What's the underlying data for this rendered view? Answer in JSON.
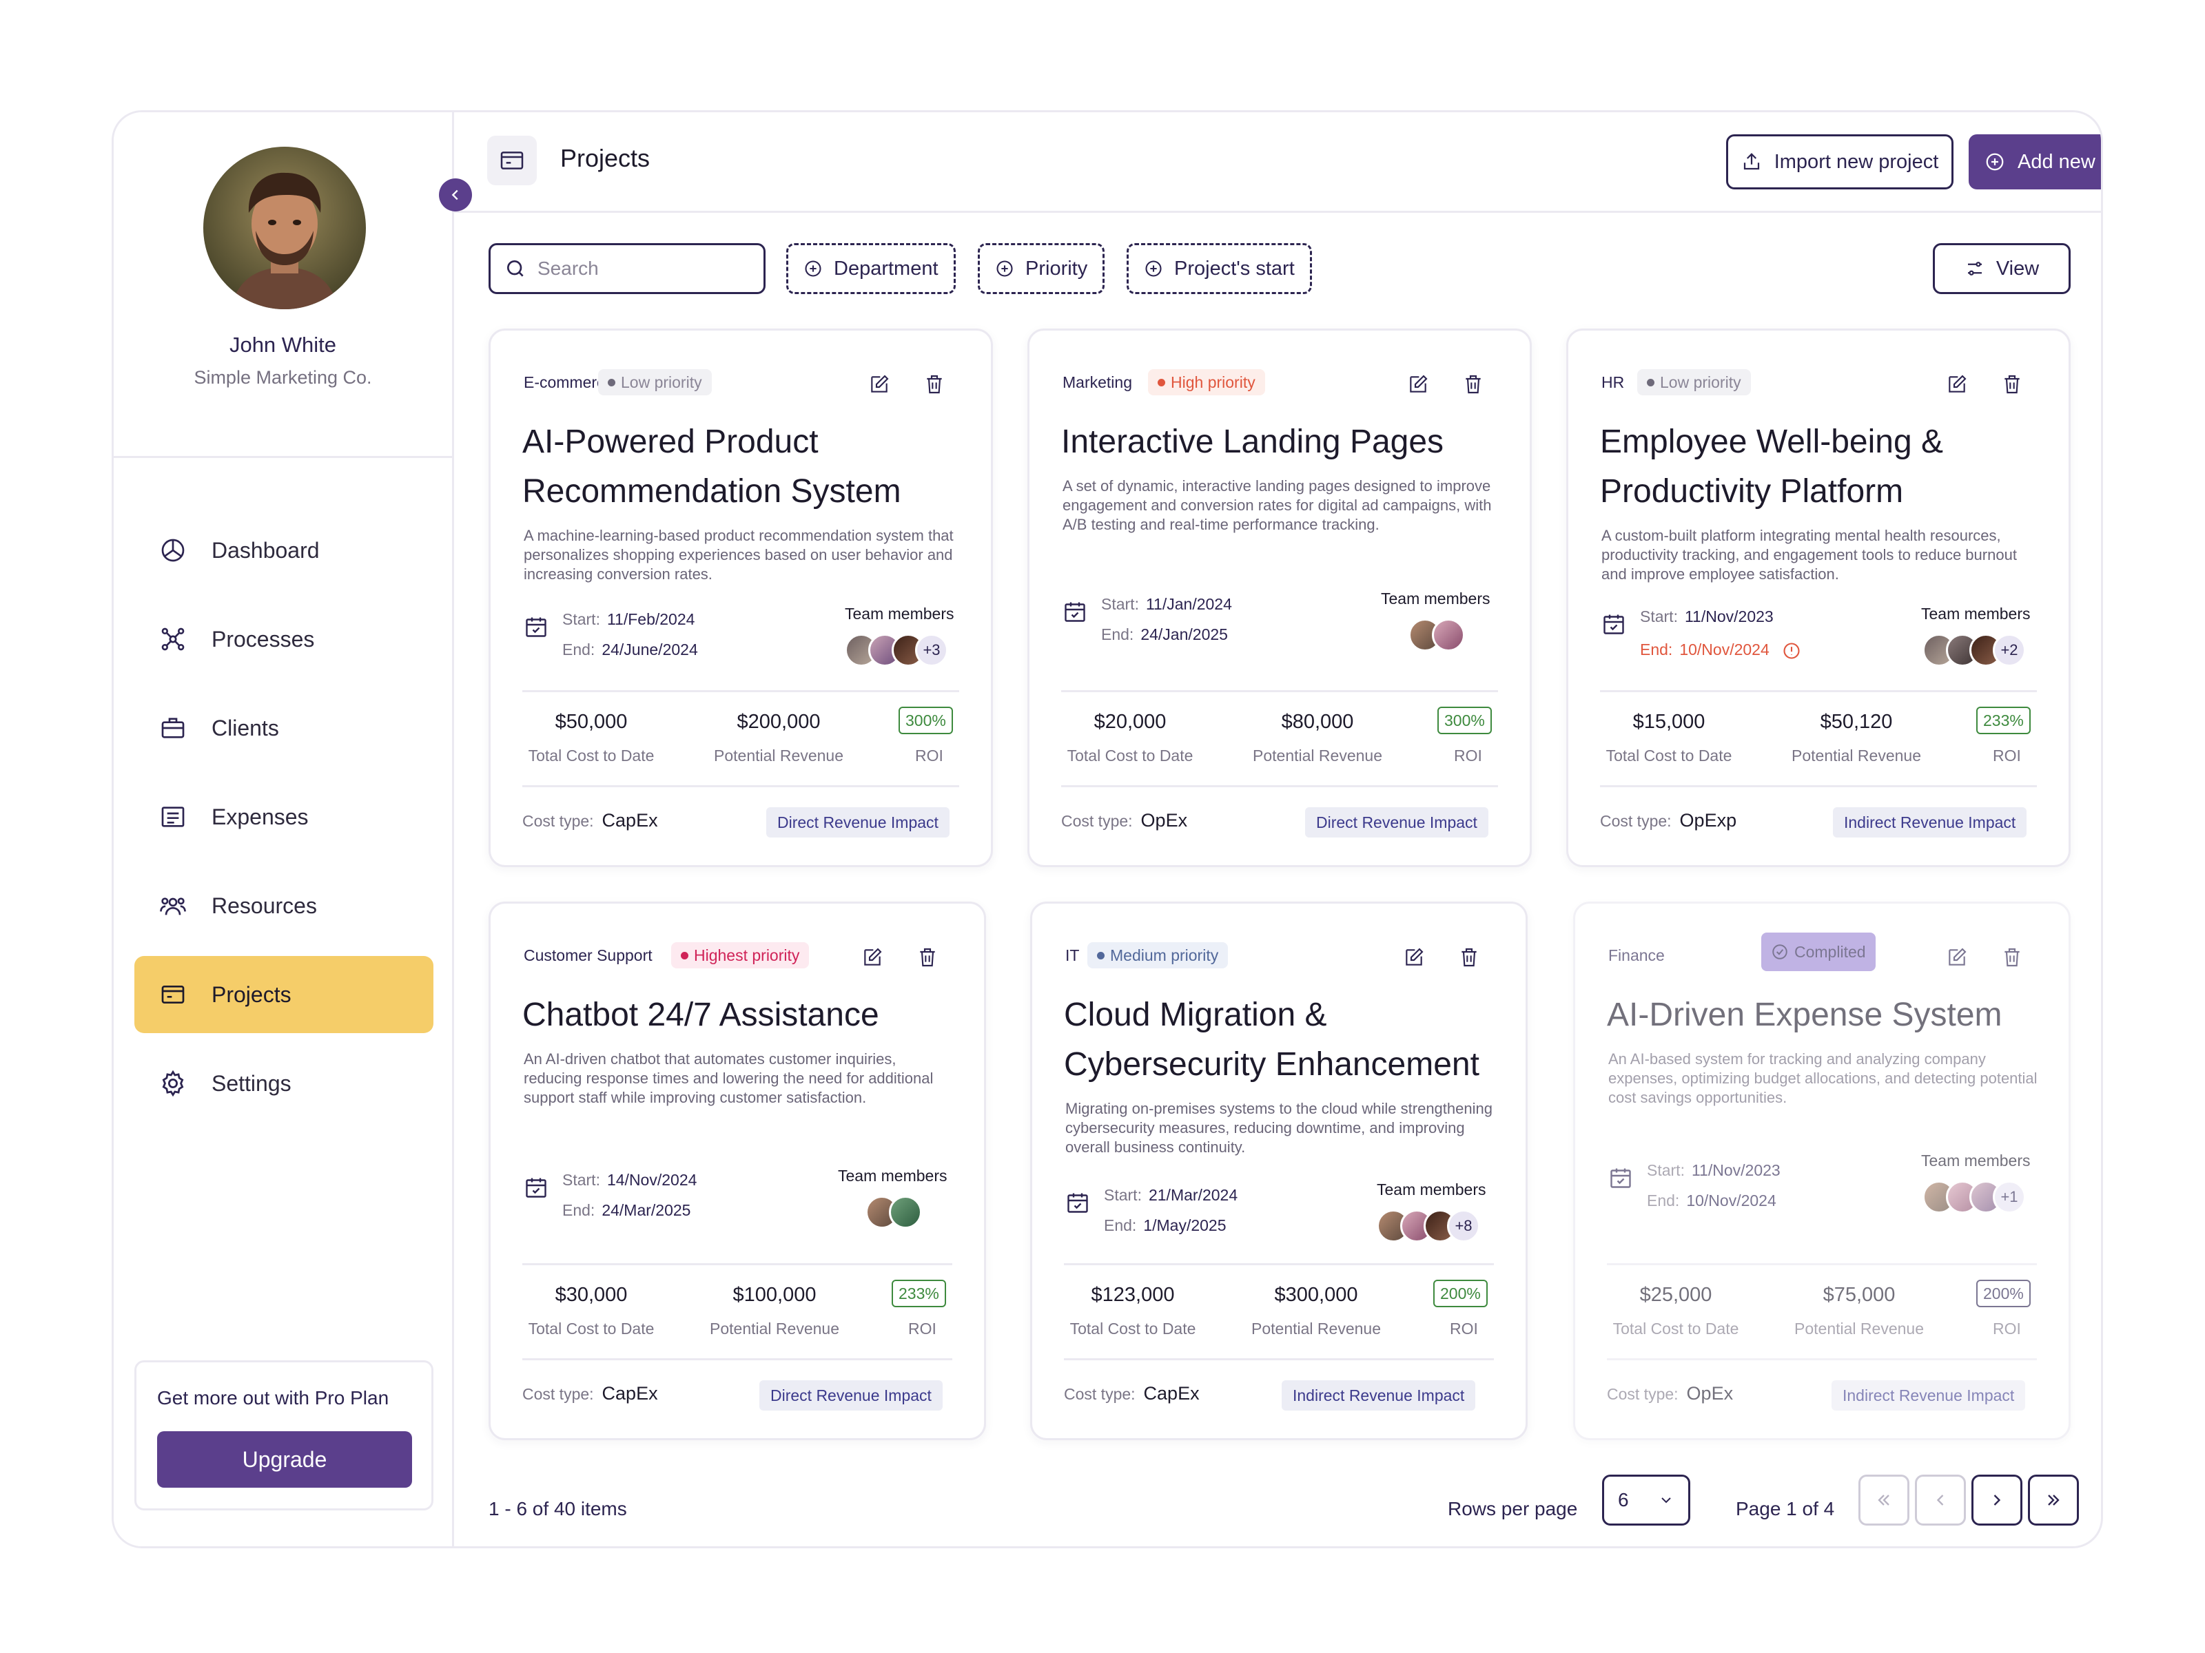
{
  "sidebar": {
    "user": {
      "name": "John White",
      "company": "Simple Marketing Co."
    },
    "nav": [
      {
        "label": "Dashboard",
        "icon": "pie-chart-icon"
      },
      {
        "label": "Processes",
        "icon": "network-icon"
      },
      {
        "label": "Clients",
        "icon": "briefcase-icon"
      },
      {
        "label": "Expenses",
        "icon": "receipt-icon"
      },
      {
        "label": "Resources",
        "icon": "people-icon"
      },
      {
        "label": "Projects",
        "icon": "wallet-icon",
        "active": true
      },
      {
        "label": "Settings",
        "icon": "gear-icon"
      }
    ],
    "promo": {
      "text": "Get more out with Pro Plan",
      "button": "Upgrade"
    }
  },
  "header": {
    "title": "Projects",
    "import_button": "Import new project",
    "add_button": "Add new project"
  },
  "toolbar": {
    "search_placeholder": "Search",
    "filters": [
      "Department",
      "Priority",
      "Project's start"
    ],
    "view_button": "View"
  },
  "labels": {
    "team_members": "Team members",
    "start": "Start:",
    "end": "End:",
    "total_cost": "Total Cost to Date",
    "potential_revenue": "Potential Revenue",
    "roi": "ROI",
    "cost_type": "Cost type:"
  },
  "projects": [
    {
      "department": "E-commerce",
      "priority": "Low priority",
      "title": "AI-Powered Product Recommendation System",
      "description": "A machine-learning-based product recommendation system that personalizes shopping experiences based on user behavior and increasing conversion rates.",
      "start": "11/Feb/2024",
      "end": "24/June/2024",
      "members_extra": "+3",
      "total_cost": "$50,000",
      "potential_revenue": "$200,000",
      "roi": "300%",
      "cost_type": "CapEx",
      "impact": "Direct Revenue Impact"
    },
    {
      "department": "Marketing",
      "priority": "High priority",
      "title": "Interactive Landing Pages",
      "description": "A set of dynamic, interactive landing pages designed to improve engagement and conversion rates for digital ad campaigns, with A/B testing and real-time performance tracking.",
      "start": "11/Jan/2024",
      "end": "24/Jan/2025",
      "total_cost": "$20,000",
      "potential_revenue": "$80,000",
      "roi": "300%",
      "cost_type": "OpEx",
      "impact": "Direct Revenue Impact"
    },
    {
      "department": "HR",
      "priority": "Low priority",
      "title": "Employee Well-being & Productivity Platform",
      "description": "A custom-built platform integrating mental health resources, productivity tracking, and engagement tools to reduce burnout and improve employee satisfaction.",
      "start": "11/Nov/2023",
      "end": "10/Nov/2024",
      "members_extra": "+2",
      "total_cost": "$15,000",
      "potential_revenue": "$50,120",
      "roi": "233%",
      "cost_type": "OpExp",
      "impact": "Indirect Revenue Impact"
    },
    {
      "department": "Customer Support",
      "priority": "Highest priority",
      "title": "Chatbot 24/7 Assistance",
      "description": "An AI-driven chatbot that automates customer inquiries, reducing response times and lowering the need for additional support staff while improving customer satisfaction.",
      "start": "14/Nov/2024",
      "end": "24/Mar/2025",
      "total_cost": "$30,000",
      "potential_revenue": "$100,000",
      "roi": "233%",
      "cost_type": "CapEx",
      "impact": "Direct Revenue Impact"
    },
    {
      "department": "IT",
      "priority": "Medium priority",
      "title": "Cloud Migration & Cybersecurity Enhancement",
      "description": "Migrating on-premises systems to the cloud while strengthening cybersecurity measures, reducing downtime, and improving overall business continuity.",
      "start": "21/Mar/2024",
      "end": "1/May/2025",
      "members_extra": "+8",
      "total_cost": "$123,000",
      "potential_revenue": "$300,000",
      "roi": "200%",
      "cost_type": "CapEx",
      "impact": "Indirect Revenue Impact"
    },
    {
      "department": "Finance",
      "priority": "Complited",
      "title": "AI-Driven Expense System",
      "description": "An AI-based system for tracking and analyzing company expenses, optimizing budget allocations, and detecting potential cost savings opportunities.",
      "start": "11/Nov/2023",
      "end": "10/Nov/2024",
      "members_extra": "+1",
      "total_cost": "$25,000",
      "potential_revenue": "$75,000",
      "roi": "200%",
      "cost_type": "OpEx",
      "impact": "Indirect Revenue Impact"
    }
  ],
  "pagination": {
    "items_text": "1 - 6 of 40 items",
    "rows_label": "Rows per page",
    "rows_value": "6",
    "page_text": "Page 1 of 4"
  },
  "colors": {
    "primary": "#5b3f8c",
    "active_nav": "#f5cd69",
    "roi_green": "#3e8a3e",
    "overdue_red": "#e0563d"
  }
}
